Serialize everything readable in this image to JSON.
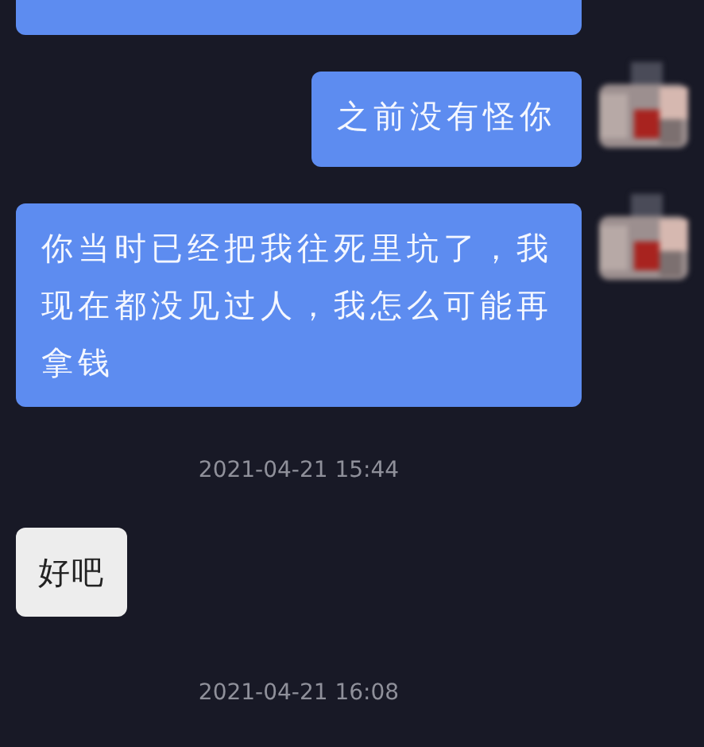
{
  "messages": [
    {
      "kind": "sent",
      "avatar": false
    },
    {
      "kind": "sent",
      "avatar": true,
      "text": "之前没有怪你"
    },
    {
      "kind": "sent",
      "avatar": true,
      "text": "你当时已经把我往死里坑了，我现在都没见过人，我怎么可能再拿钱"
    },
    {
      "kind": "time",
      "text": "2021-04-21 15:44"
    },
    {
      "kind": "received",
      "text": "好吧"
    },
    {
      "kind": "time",
      "text": "2021-04-21 16:08"
    }
  ]
}
